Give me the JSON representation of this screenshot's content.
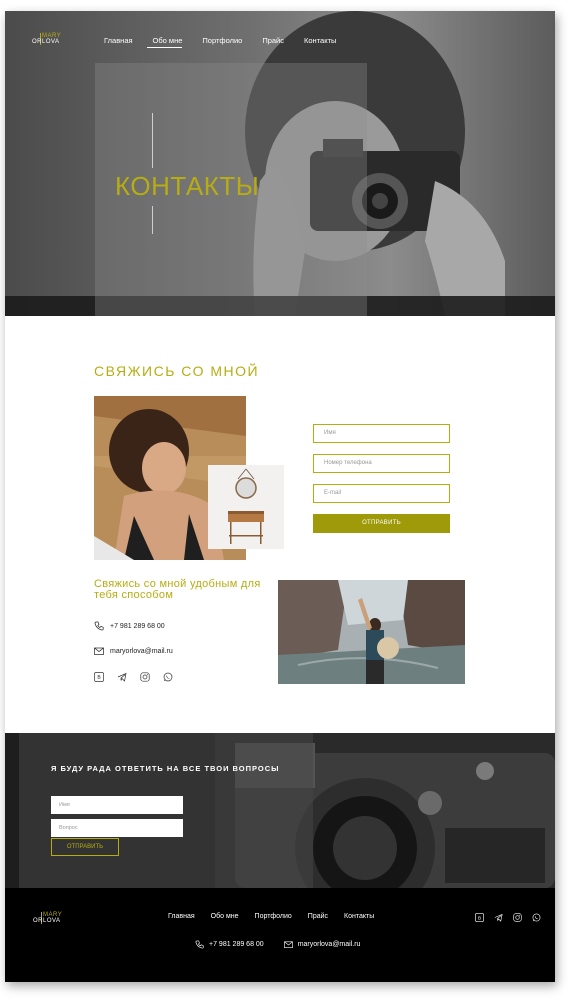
{
  "logo": {
    "line1": "MARY",
    "line2": "ORLOVA"
  },
  "nav": {
    "items": [
      {
        "label": "Главная"
      },
      {
        "label": "Обо мне"
      },
      {
        "label": "Портфолио"
      },
      {
        "label": "Прайс"
      },
      {
        "label": "Контакты"
      }
    ],
    "active_index": 1
  },
  "hero": {
    "title": "КОНТАКТЫ"
  },
  "contact": {
    "title": "СВЯЖИСЬ СО МНОЙ",
    "form": {
      "name_placeholder": "Имя",
      "phone_placeholder": "Номер телефона",
      "email_placeholder": "E-mail",
      "submit_label": "ОТПРАВИТЬ"
    },
    "reach_title": "Свяжись со мной удобным для тебя способом",
    "phone": "+7 981 289 68 00",
    "email": "maryorlova@mail.ru",
    "socials": [
      "vk-icon",
      "telegram-icon",
      "instagram-icon",
      "whatsapp-icon"
    ]
  },
  "questions": {
    "title": "Я БУДУ РАДА ОТВЕТИТЬ НА ВСЕ ТВОИ ВОПРОСЫ",
    "name_placeholder": "Имя",
    "question_placeholder": "Вопрос",
    "submit_label": "ОТПРАВИТЬ"
  },
  "footer": {
    "nav": [
      "Главная",
      "Обо мне",
      "Портфолио",
      "Прайс",
      "Контакты"
    ],
    "phone": "+7 981 289 68 00",
    "email": "maryorlova@mail.ru"
  },
  "colors": {
    "accent": "#b7ad12",
    "button": "#9e9a0a",
    "dark": "#000000"
  }
}
